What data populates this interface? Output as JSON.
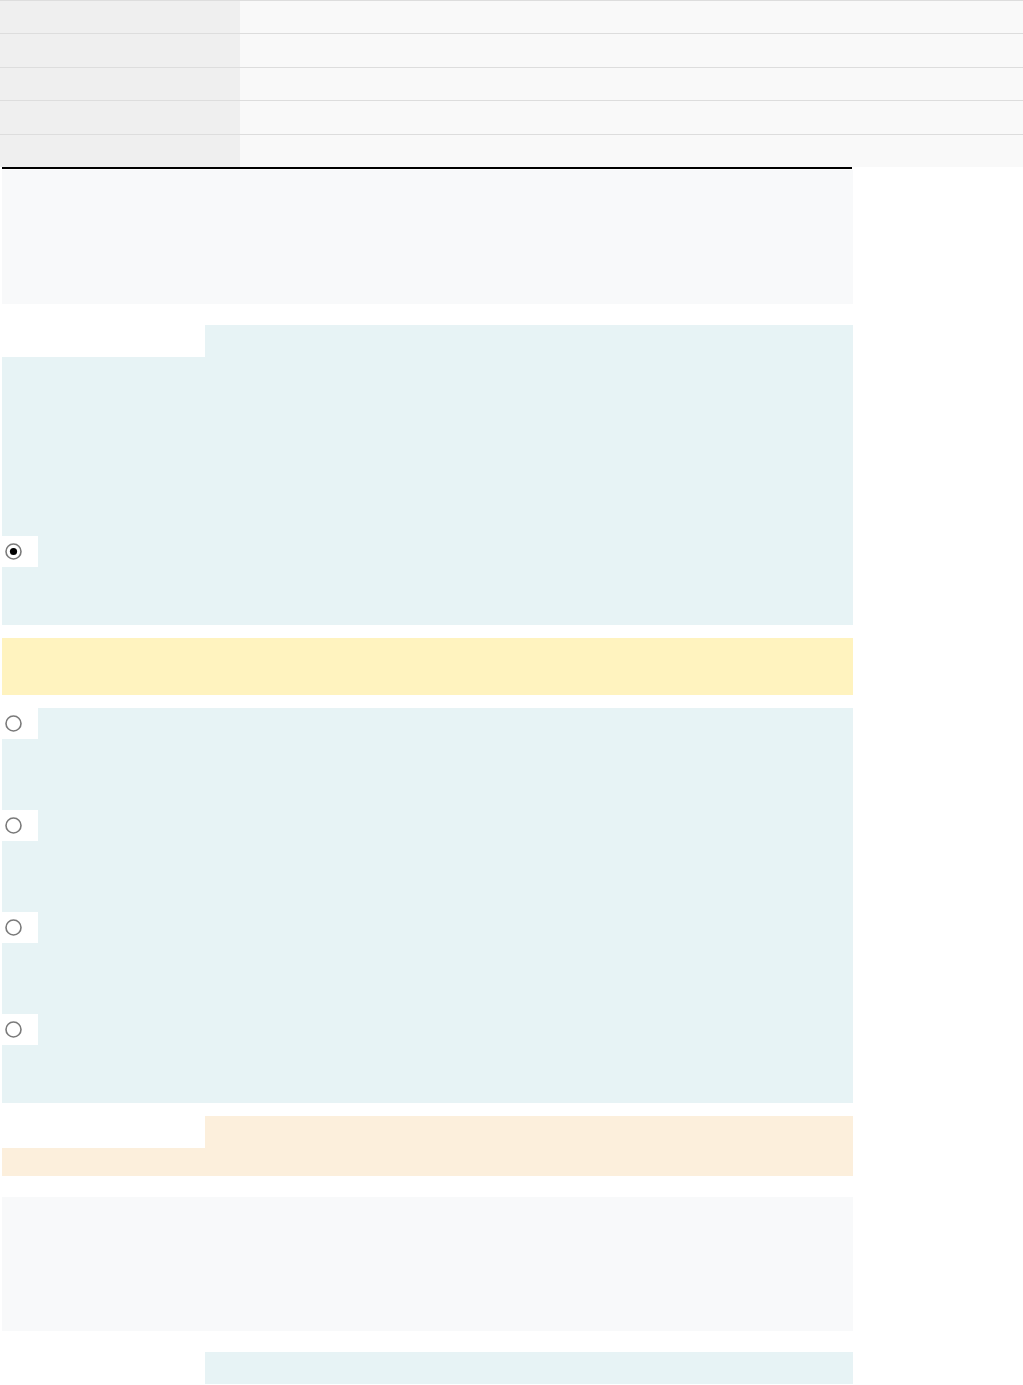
{
  "summary_table": {
    "rows": [
      {},
      {},
      {},
      {},
      {}
    ]
  },
  "blocks": [
    {
      "kind": "info"
    },
    {
      "kind": "prompt",
      "options": [
        {
          "selected": true
        }
      ]
    },
    {
      "kind": "feedback"
    },
    {
      "kind": "answers",
      "options": [
        {
          "selected": false
        },
        {
          "selected": false
        },
        {
          "selected": false
        },
        {
          "selected": false
        }
      ]
    },
    {
      "kind": "comment"
    },
    {
      "kind": "info"
    },
    {
      "kind": "prompt"
    }
  ]
}
